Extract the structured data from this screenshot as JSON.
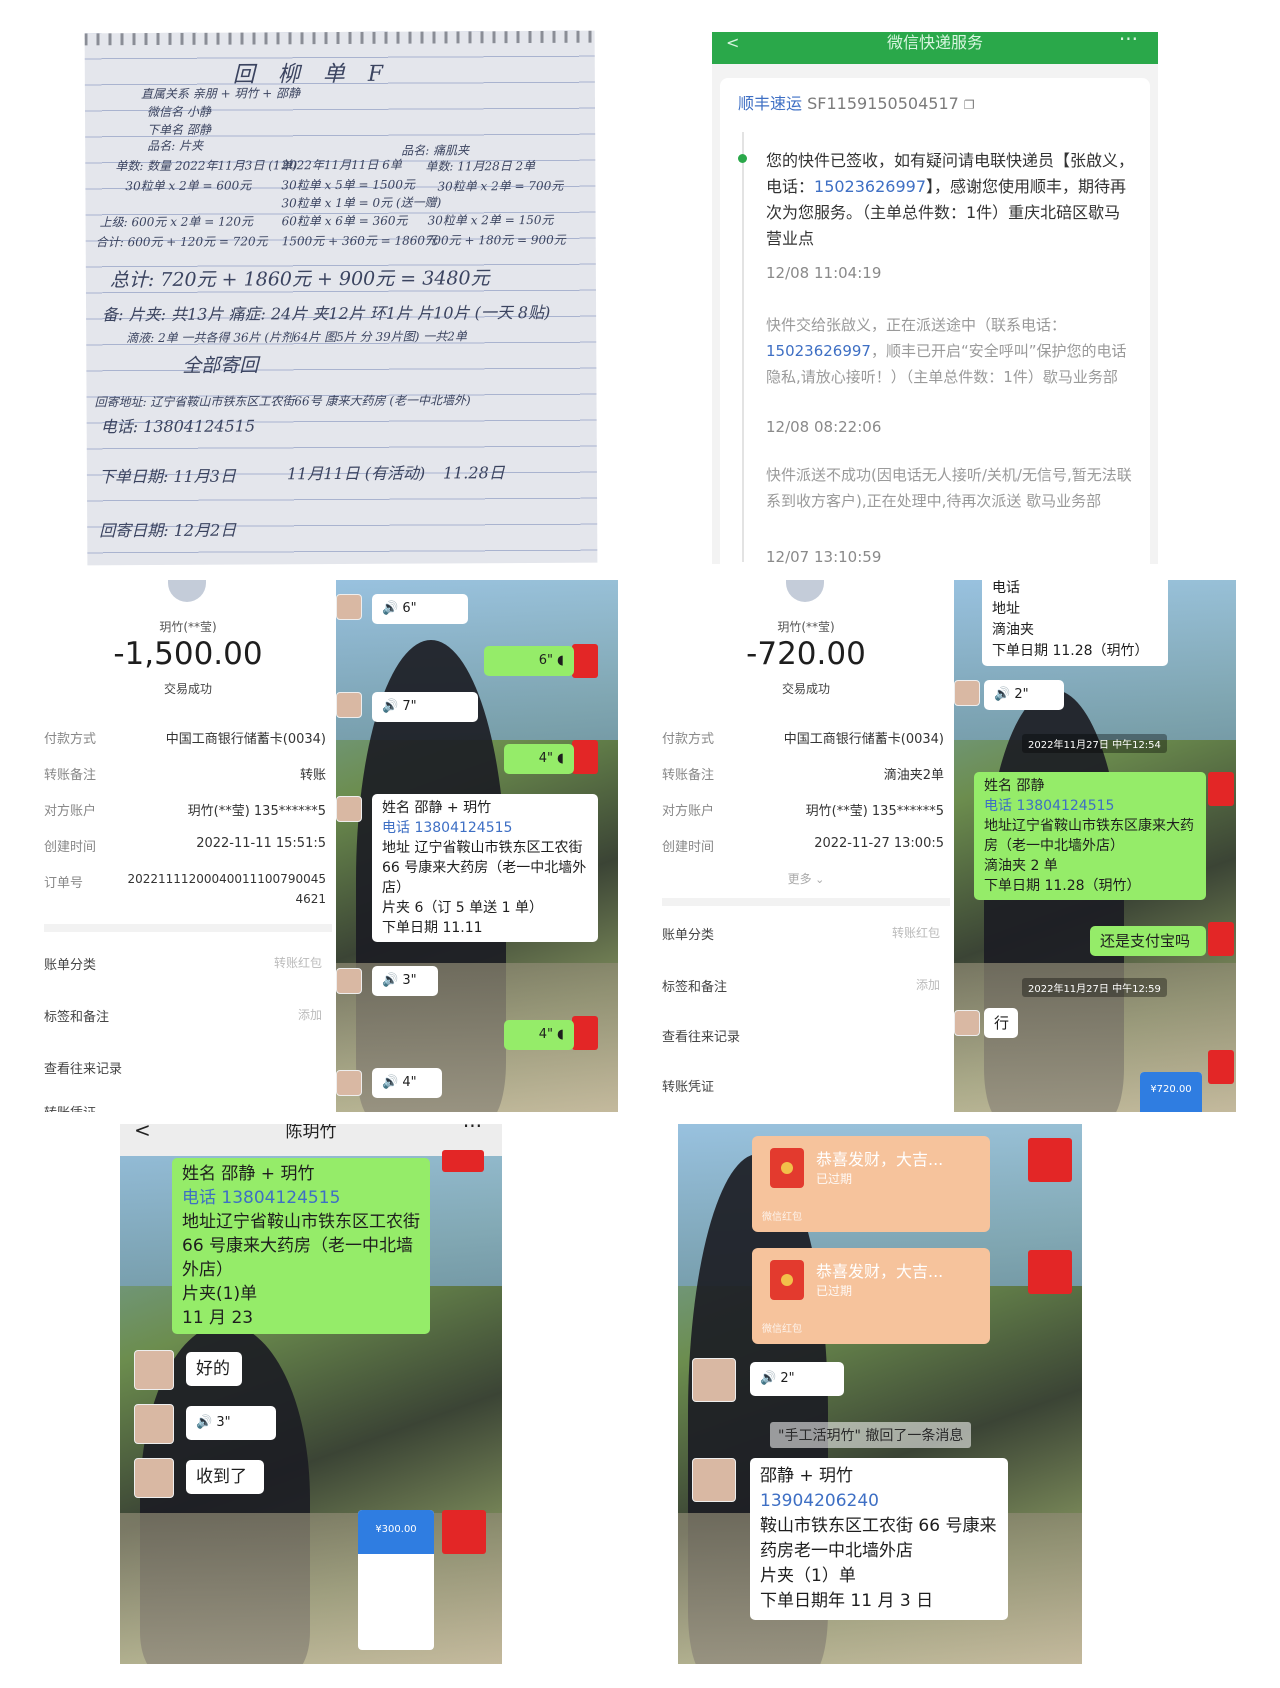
{
  "notebook": {
    "title": "回 柳 单 F",
    "lines": [
      "直属关系 亲朋 + 玥竹 + 邵静",
      "微信名 小静",
      "下单名 邵静",
      "品名: 片夹",
      "品名: 痛肌夹",
      "单数: 数量 2022年11月3日 (1单)",
      "2022年11月11日 6单",
      "单数: 11月28日 2单",
      "30粒单 x 2单 = 600元",
      "30粒单 x 5单 = 1500元",
      "30粒单 x 2单 = 700元",
      "30粒单 x 1单 = 0元 (送一赠)",
      "上级: 600元 x 2单 = 120元",
      "60粒单 x 6单 = 360元",
      "30粒单 x 2单 = 150元",
      "合计: 600元 + 120元 = 720元",
      "1500元 + 360元 = 1860元",
      "700元 + 180元 = 900元",
      "总计: 720元 + 1860元 + 900元 = 3480元",
      "备: 片夹: 共13片 痛症: 24片 夹12片 环1片 片10片 (一天 8贴)",
      "滴液: 2单 一共各得 36片 (片剂64片 图5片 分 39片图) 一共2单",
      "全部寄回",
      "回寄地址: 辽宁省鞍山市铁东区工农街66号 康来大药房 (老一中北墙外)",
      "电话: 13804124515",
      "下单日期: 11月3日",
      "11月11日 (有活动)",
      "11.28日",
      "回寄日期: 12月2日"
    ]
  },
  "sf_express": {
    "window_title": "微信快递服务",
    "back": "<",
    "more": "···",
    "carrier": "顺丰速运",
    "tracking_no": "SF1159150504517",
    "copy_icon": "copy-icon",
    "events": [
      {
        "text_a": "您的快件已签收，如有疑问请电联快递员【张啟义，电话：",
        "phone": "15023626997",
        "text_b": "】，感谢您使用顺丰，期待再次为您服务。（主单总件数：1件）重庆北碚区歇马营业点",
        "time": "12/08 11:04:19"
      },
      {
        "text_a": "快件交给张啟义，正在派送途中（联系电话：",
        "phone": "15023626997",
        "text_b": "，顺丰已开启“安全呼叫”保护您的电话隐私,请放心接听！）（主单总件数：1件）歇马业务部",
        "time": "12/08 08:22:06"
      },
      {
        "text_a": "快件派送不成功(因电话无人接听/关机/无信号,暂无法联系到收方客户),正在处理中,待再次派送 歇马业务部",
        "phone": "",
        "text_b": "",
        "time": "12/07 13:10:59"
      }
    ]
  },
  "payment1": {
    "payee": "玥竹(**莹)",
    "amount": "-1,500.00",
    "status": "交易成功",
    "rows": [
      {
        "label": "付款方式",
        "value": "中国工商银行储蓄卡(0034)"
      },
      {
        "label": "转账备注",
        "value": "转账"
      },
      {
        "label": "对方账户",
        "value": "玥竹(**莹) 135******5"
      },
      {
        "label": "创建时间",
        "value": "2022-11-11 15:51:5"
      },
      {
        "label": "订单号",
        "value": "20221111200040011100790045"
      },
      {
        "label": "",
        "value": "4621"
      }
    ],
    "actions": [
      {
        "label": "账单分类",
        "value": "转账红包"
      },
      {
        "label": "标签和备注",
        "value": "添加"
      },
      {
        "label": "查看往来记录",
        "value": ""
      },
      {
        "label": "转账凭证",
        "value": ""
      }
    ]
  },
  "chat1": {
    "messages": [
      {
        "type": "voice-in",
        "text": "6\""
      },
      {
        "type": "voice-out",
        "text": "6\""
      },
      {
        "type": "voice-in",
        "text": "7\""
      },
      {
        "type": "voice-out",
        "text": "4\""
      },
      {
        "type": "order",
        "lines": [
          "姓名 邵静 + 玥竹",
          "电话 13804124515",
          "地址 辽宁省鞍山市铁东区工农街 66 号康来大药房（老一中北墙外店）",
          "片夹 6（订 5 单送 1 单）",
          "下单日期 11.11"
        ]
      },
      {
        "type": "voice-in",
        "text": "3\""
      },
      {
        "type": "voice-out",
        "text": "4\""
      },
      {
        "type": "voice-in",
        "text": "4\""
      }
    ]
  },
  "payment2": {
    "payee": "玥竹(**莹)",
    "amount": "-720.00",
    "status": "交易成功",
    "rows": [
      {
        "label": "付款方式",
        "value": "中国工商银行储蓄卡(0034)"
      },
      {
        "label": "转账备注",
        "value": "滴油夹2单"
      },
      {
        "label": "对方账户",
        "value": "玥竹(**莹) 135******5"
      },
      {
        "label": "创建时间",
        "value": "2022-11-27 13:00:5"
      }
    ],
    "more_label": "更多",
    "actions": [
      {
        "label": "账单分类",
        "value": "转账红包"
      },
      {
        "label": "标签和备注",
        "value": "添加"
      },
      {
        "label": "查看往来记录",
        "value": ""
      },
      {
        "label": "转账凭证",
        "value": ""
      }
    ]
  },
  "chat2": {
    "top_lines": [
      "电话",
      "地址",
      "滴油夹",
      "下单日期 11.28（玥竹）"
    ],
    "voice1": "2\"",
    "time1": "2022年11月27日 中午12:54",
    "order_lines": [
      "姓名 邵静",
      "电话 13804124515",
      "地址辽宁省鞍山市铁东区康来大药房（老一中北墙外店）",
      "滴油夹 2 单",
      "下单日期 11.28（玥竹）"
    ],
    "reply": "还是支付宝吗",
    "time2": "2022年11月27日 中午12:59",
    "answer": "行",
    "mini_amount": "¥720.00"
  },
  "chat3": {
    "title": "陈玥竹",
    "back": "<",
    "more": "···",
    "order_lines": [
      "姓名 邵静 + 玥竹",
      "电话 13804124515",
      "地址辽宁省鞍山市铁东区工农街 66 号康来大药房（老一中北墙外店）",
      "片夹(1)单",
      "11 月 23"
    ],
    "reply1": "好的",
    "voice": "3\"",
    "reply2": "收到了",
    "mini_amount": "¥300.00"
  },
  "chat4": {
    "packets": [
      {
        "title": "恭喜发财，大吉...",
        "sub": "已过期",
        "foot": "微信红包"
      },
      {
        "title": "恭喜发财，大吉...",
        "sub": "已过期",
        "foot": "微信红包"
      }
    ],
    "voice": "2\"",
    "recall": "\"手工活玥竹\" 撤回了一条消息",
    "order_lines": [
      "邵静 + 玥竹",
      "13904206240",
      "鞍山市铁东区工农街 66 号康来药房老一中北墙外店",
      "片夹（1）单",
      "下单日期年 11 月 3 日"
    ]
  },
  "colors": {
    "wechat_green": "#95ec69",
    "sf_green": "#2aa84a",
    "link_blue": "#3e6fc4",
    "red_packet": "#e32626"
  }
}
